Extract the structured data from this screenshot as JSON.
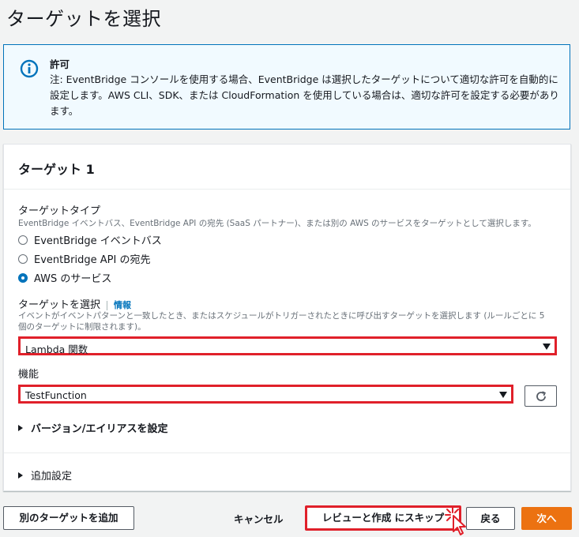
{
  "page": {
    "title": "ターゲットを選択"
  },
  "info": {
    "title": "許可",
    "text": "注: EventBridge コンソールを使用する場合、EventBridge は選択したターゲットについて適切な許可を自動的に設定します。AWS CLI、SDK、または CloudFormation を使用している場合は、適切な許可を設定する必要があります。"
  },
  "target": {
    "heading": "ターゲット 1",
    "type_label": "ターゲットタイプ",
    "type_desc": "EventBridge イベントバス、EventBridge API の宛先 (SaaS パートナー)、または別の AWS のサービスをターゲットとして選択します。",
    "options": [
      {
        "label": "EventBridge イベントバス",
        "selected": false
      },
      {
        "label": "EventBridge API の宛先",
        "selected": false
      },
      {
        "label": "AWS のサービス",
        "selected": true
      }
    ],
    "select_label": "ターゲットを選択",
    "info_link": "情報",
    "select_desc": "イベントがイベントパターンと一致したとき、またはスケジュールがトリガーされたときに呼び出すターゲットを選択します (ルールごとに 5 個のターゲットに制限されます)。",
    "select_value": "Lambda 関数",
    "function_label": "機能",
    "function_value": "TestFunction",
    "version_expander": "バージョン/エイリアスを設定",
    "additional_settings": "追加設定"
  },
  "footer": {
    "add_target": "別のターゲットを追加",
    "cancel": "キャンセル",
    "skip_to_review": "レビューと作成 にスキップ",
    "back": "戻る",
    "next": "次へ"
  },
  "colors": {
    "accent": "#0073bb",
    "primary": "#ec7211",
    "highlight": "#e0202a"
  }
}
